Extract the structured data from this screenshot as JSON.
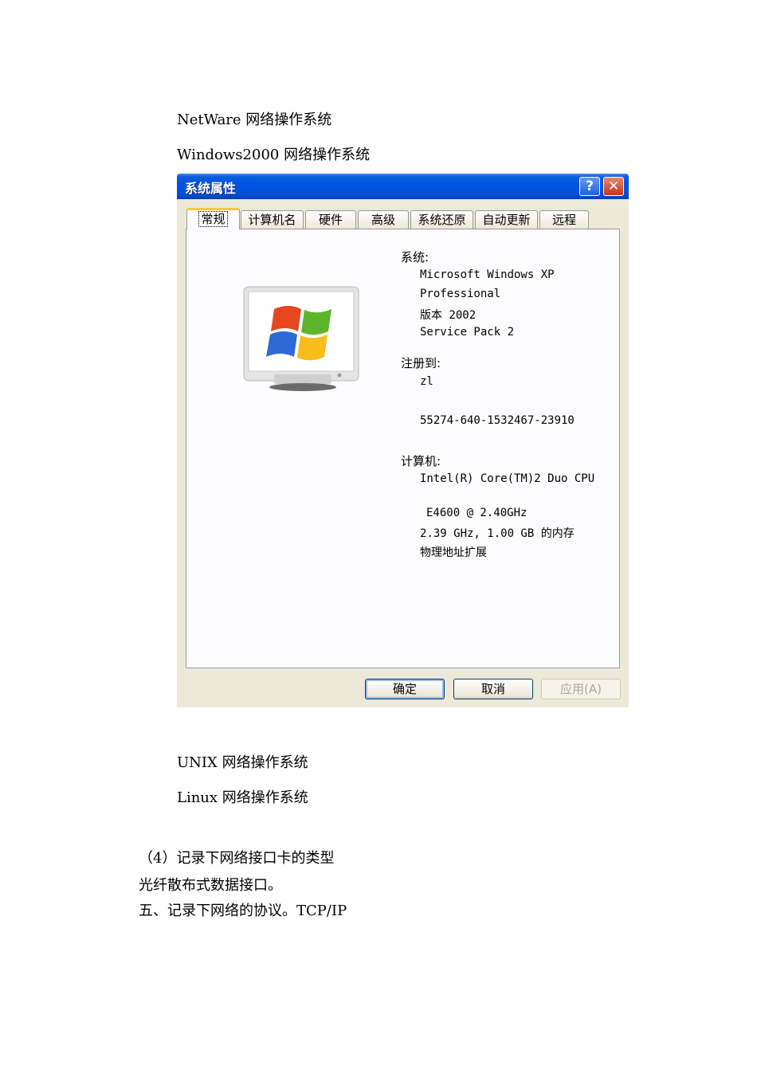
{
  "doc": {
    "line_netware": "NetWare 网络操作系统",
    "line_windows2000": "Windows2000 网络操作系统",
    "line_unix": "UNIX 网络操作系统",
    "line_linux": "Linux 网络操作系统",
    "line_step4": "（4）记录下网络接口卡的类型",
    "line_fiber": "光纤散布式数据接口。",
    "line_protocol": "五、记录下网络的协议。TCP/IP"
  },
  "dialog": {
    "title": "系统属性",
    "help_label": "?",
    "close_label": "✕",
    "tabs": [
      "常规",
      "计算机名",
      "硬件",
      "高级",
      "系统还原",
      "自动更新",
      "远程"
    ],
    "system_label": "系统:",
    "os_name_1": "Microsoft Windows XP",
    "os_name_2": "Professional",
    "os_version": "版本 2002",
    "service_pack": "Service Pack 2",
    "registered_label": "注册到:",
    "registered_user": "zl",
    "product_id": "55274-640-1532467-23910",
    "computer_label": "计算机:",
    "cpu_1": "Intel(R) Core(TM)2 Duo CPU",
    "cpu_2": "E4600  @ 2.40GHz",
    "cpu_3": "2.39 GHz, 1.00 GB 的内存",
    "pae": "物理地址扩展",
    "ok_label": "确定",
    "cancel_label": "取消",
    "apply_label": "应用(A)",
    "monitor_icon": "windows-xp-monitor-icon",
    "colors": {
      "titlebar": "#0054e3",
      "dialog_bg": "#ece9d8",
      "close": "#c4361b"
    }
  }
}
